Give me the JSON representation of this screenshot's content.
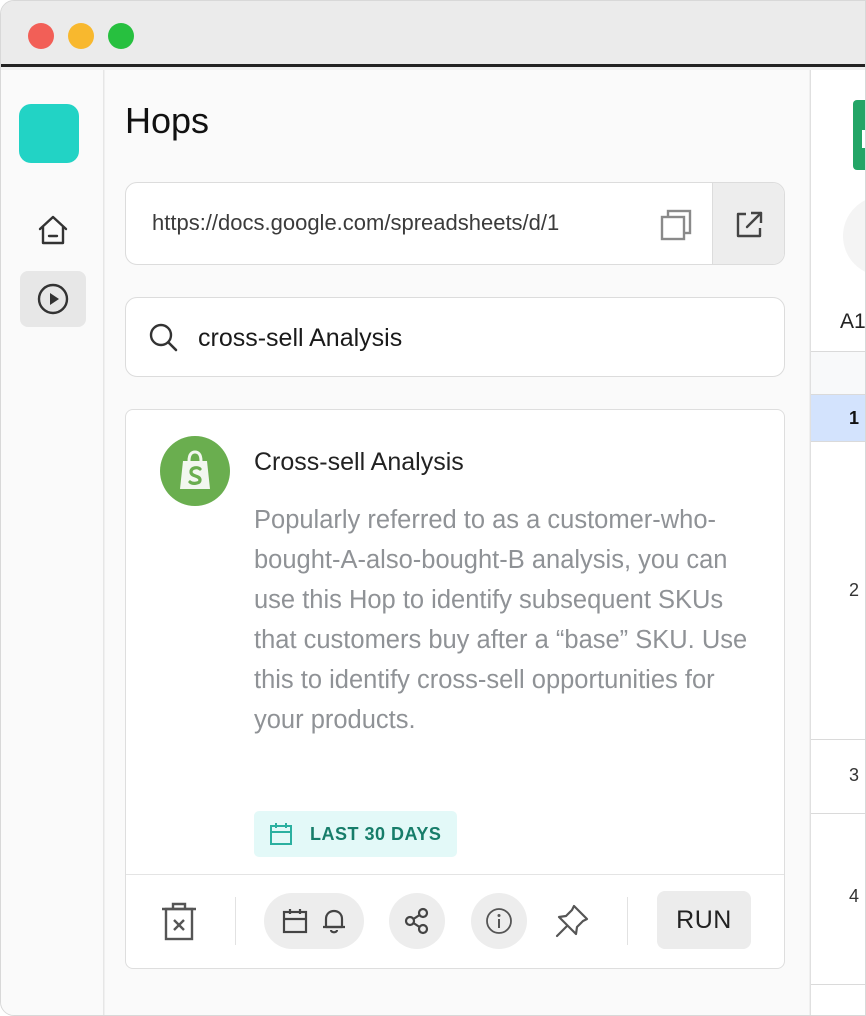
{
  "app": {
    "title": "Hops"
  },
  "url_bar": {
    "value": "https://docs.google.com/spreadsheets/d/1"
  },
  "search": {
    "value": "cross-sell Analysis"
  },
  "hop_card": {
    "title": "Cross-sell Analysis",
    "description": "Popularly referred to as a customer-who-bought-A-also-bought-B analysis, you can use this Hop to identify subsequent SKUs that customers buy after a “base” SKU. Use this to identify cross-sell opportunities for your products.",
    "badge_label": "LAST 30 DAYS",
    "run_label": "RUN",
    "integration_icon": "shopify-bag-icon"
  },
  "sheet_preview": {
    "cell_ref": "A1",
    "rows": [
      "1",
      "2",
      "3",
      "4"
    ]
  },
  "colors": {
    "accent": "#22d3c5",
    "shopify_green": "#6aae4f",
    "badge_bg": "#e3f9f8",
    "badge_text": "#177d6a",
    "selected_row": "#d3e3fd"
  }
}
